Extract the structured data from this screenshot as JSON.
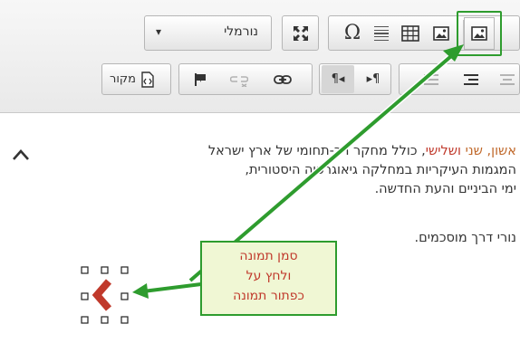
{
  "toolbar": {
    "format_select": {
      "value": "נורמלי",
      "arrow": "▾"
    },
    "icons": {
      "maximize": "maximize-icon",
      "special_char": "Ω",
      "horizontal_rule": "horizontal-line-icon",
      "table": "table-icon",
      "image": "image-icon",
      "source": "source-icon",
      "anchor": "flag-icon",
      "unlink": "unlink-icon",
      "link": "link-icon",
      "ltr": "¶◂",
      "rtl": "▸¶",
      "align_right": "align-right-icon",
      "align_center": "align-center-icon"
    },
    "source_label": "מקור"
  },
  "content": {
    "line1_highlight1": "אשון,",
    "line1_highlight2": "שני",
    "line1_highlight3": "ושלישי",
    "line1_rest": ", כולל מחקר רב-תחומי של ארץ ישראל",
    "line2": "המגמות העיקריות במחלקה גיאוגרפיה היסטורית,",
    "line3": "ימי הביניים והעת החדשה.",
    "line4": "נורי דרך מוסכמים."
  },
  "callout": {
    "line1": "סמן תמונה",
    "line2": "ולחץ על",
    "line3": "כפתור תמונה"
  },
  "colors": {
    "highlight_orange": "#c0682a",
    "highlight_red": "#c0392b",
    "arrow_green": "#2e9c2e",
    "image_red": "#c0392b"
  }
}
